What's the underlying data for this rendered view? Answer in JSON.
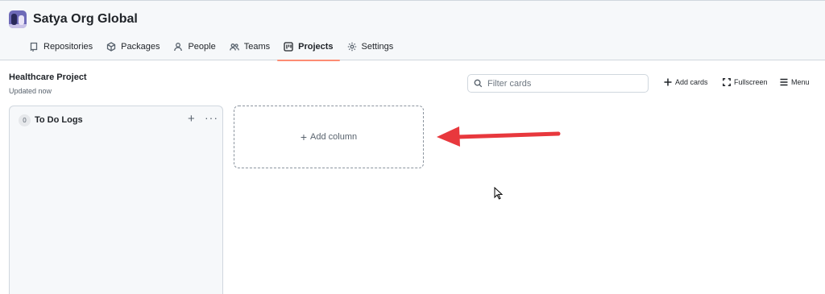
{
  "org": {
    "name": "Satya Org Global"
  },
  "nav": {
    "repositories": "Repositories",
    "packages": "Packages",
    "people": "People",
    "teams": "Teams",
    "projects": "Projects",
    "settings": "Settings",
    "active": "Projects"
  },
  "project": {
    "title": "Healthcare Project",
    "updated": "Updated now"
  },
  "toolbar": {
    "filter_placeholder": "Filter cards",
    "add_cards": "Add cards",
    "fullscreen": "Fullscreen",
    "menu": "Menu"
  },
  "columns": [
    {
      "count": "0",
      "title": "To Do Logs"
    }
  ],
  "add_column": {
    "label": "Add column"
  },
  "colors": {
    "accent_underline": "#fd8c73",
    "annotation_arrow": "#e8383d"
  }
}
